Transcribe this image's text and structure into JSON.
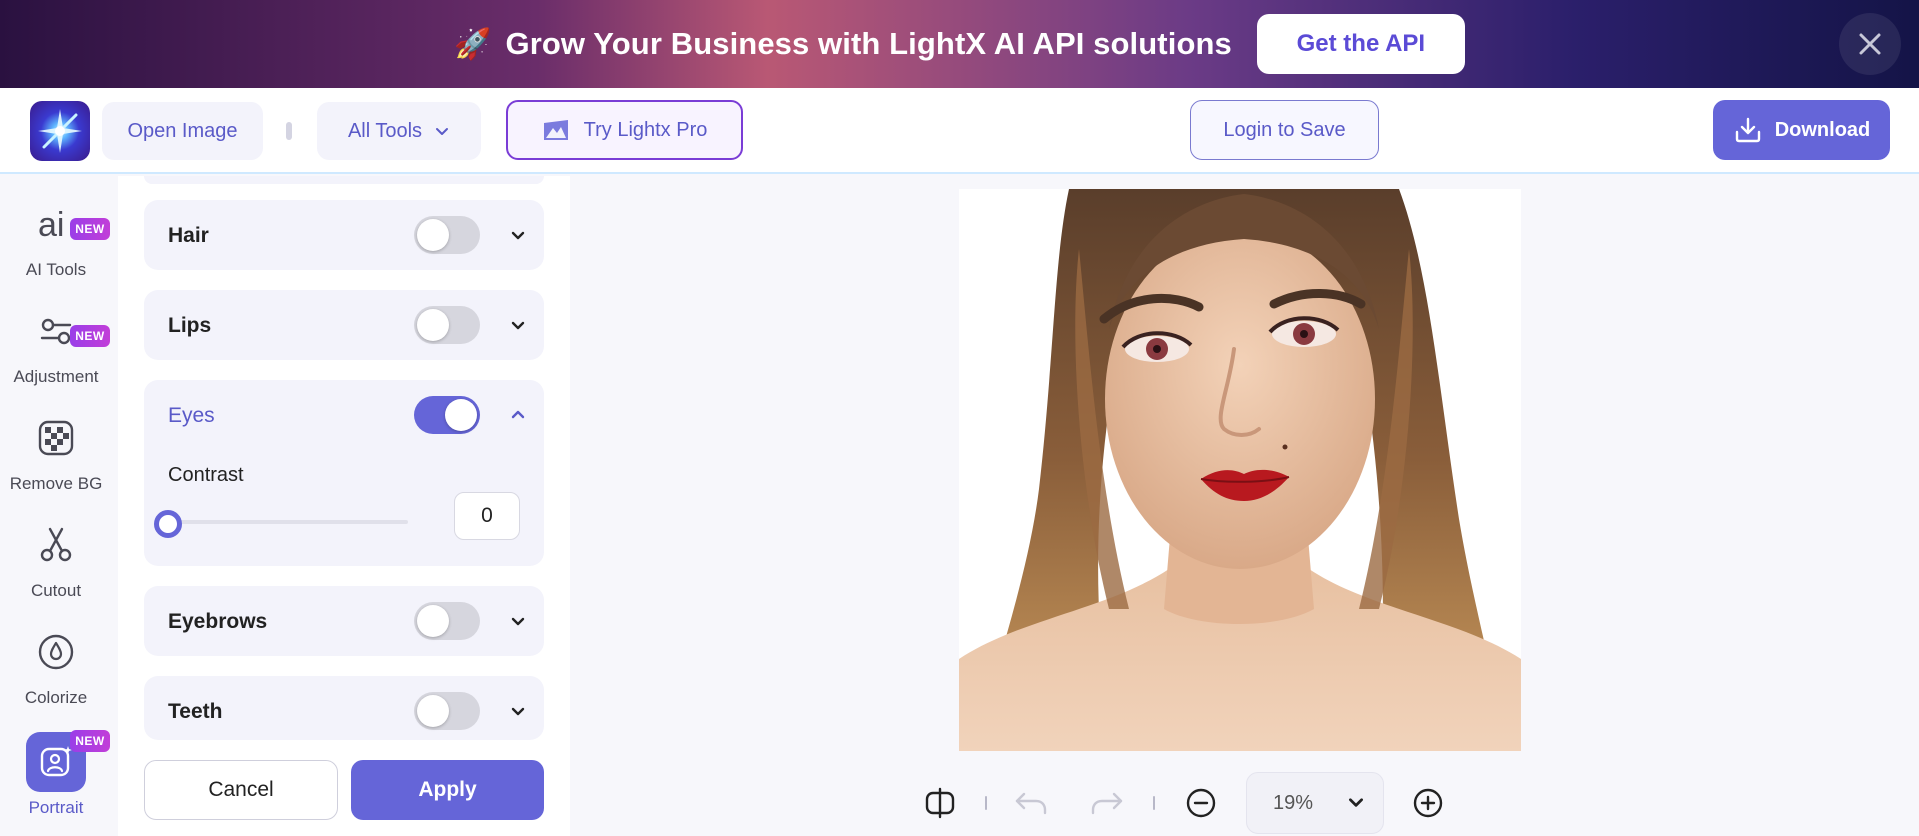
{
  "banner": {
    "emoji": "🚀",
    "text": "Grow Your Business with LightX AI API solutions",
    "cta": "Get the API"
  },
  "header": {
    "open_image": "Open Image",
    "all_tools": "All Tools",
    "try_pro": "Try Lightx Pro",
    "login_save": "Login to Save",
    "download": "Download"
  },
  "sidebar": {
    "items": [
      {
        "label": "AI Tools",
        "icon": "ai-icon",
        "badge": "NEW"
      },
      {
        "label": "Adjustment",
        "icon": "adjustment-icon",
        "badge": "NEW"
      },
      {
        "label": "Remove BG",
        "icon": "remove-bg-icon"
      },
      {
        "label": "Cutout",
        "icon": "scissors-icon"
      },
      {
        "label": "Colorize",
        "icon": "drop-icon"
      },
      {
        "label": "Portrait",
        "icon": "portrait-icon",
        "badge": "NEW",
        "active": true
      }
    ]
  },
  "panel": {
    "features": [
      {
        "name": "Hair",
        "enabled": false,
        "expanded": false
      },
      {
        "name": "Lips",
        "enabled": false,
        "expanded": false
      },
      {
        "name": "Eyes",
        "enabled": true,
        "expanded": true
      },
      {
        "name": "Eyebrows",
        "enabled": false,
        "expanded": false
      },
      {
        "name": "Teeth",
        "enabled": false,
        "expanded": false
      }
    ],
    "eyes_slider": {
      "label": "Contrast",
      "value": "0",
      "fraction": 0.0
    },
    "cancel": "Cancel",
    "apply": "Apply"
  },
  "toolbar": {
    "zoom": "19%"
  },
  "colors": {
    "accent": "#6565d8",
    "accent_text": "#5a5ac8",
    "badge": "#b03ee0"
  }
}
